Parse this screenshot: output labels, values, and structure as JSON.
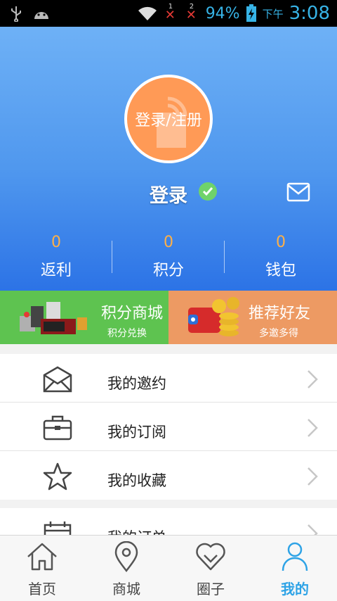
{
  "status_bar": {
    "battery": "94%",
    "time_period": "下午",
    "time": "3:08",
    "sim1": "1",
    "sim2": "2",
    "icons": [
      "usb-icon",
      "android-icon",
      "wifi-icon",
      "no-signal-icon",
      "battery-charging-icon"
    ]
  },
  "header": {
    "avatar_text": "登录/注册",
    "login_label": "登录",
    "stats": [
      {
        "value": "0",
        "label": "返利"
      },
      {
        "value": "0",
        "label": "积分"
      },
      {
        "value": "0",
        "label": "钱包"
      }
    ]
  },
  "promo": {
    "left": {
      "title": "积分商城",
      "subtitle": "积分兑换"
    },
    "right": {
      "title": "推荐好友",
      "subtitle": "多邀多得"
    }
  },
  "menu": [
    {
      "label": "我的邀约",
      "icon": "envelope-icon"
    },
    {
      "label": "我的订阅",
      "icon": "briefcase-icon"
    },
    {
      "label": "我的收藏",
      "icon": "star-icon"
    },
    {
      "label": "我的订单",
      "icon": "calendar-icon"
    }
  ],
  "tabs": [
    {
      "label": "首页",
      "icon": "home-icon"
    },
    {
      "label": "商城",
      "icon": "location-pin-icon"
    },
    {
      "label": "圈子",
      "icon": "heart-icon"
    },
    {
      "label": "我的",
      "icon": "person-icon",
      "active": true
    }
  ],
  "colors": {
    "accent": "#2ea3e6",
    "header_top": "#6eb1f6",
    "header_bottom": "#2c73e6",
    "avatar": "#ff9a56",
    "promo_left": "#5ec350",
    "promo_right": "#ed9a63",
    "stat_value": "#ffb047"
  }
}
